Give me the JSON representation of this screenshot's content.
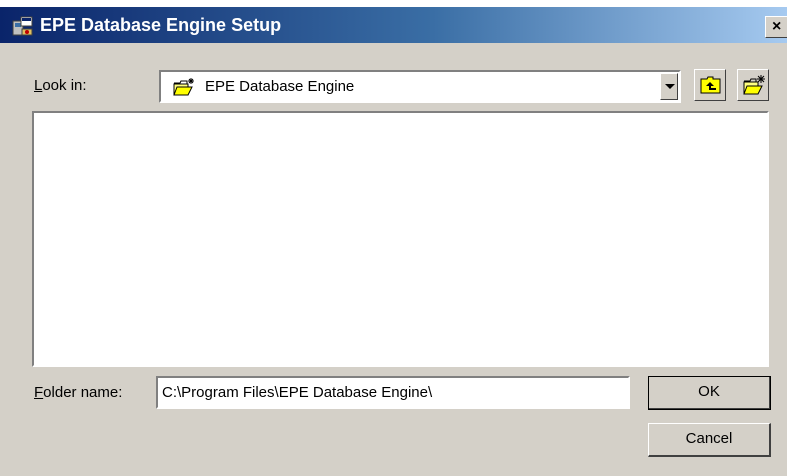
{
  "window": {
    "title": "EPE Database Engine Setup",
    "close_glyph": "×"
  },
  "look_in": {
    "label_hotkey": "L",
    "label_rest": "ook in:",
    "selected": "EPE Database Engine",
    "icon": "open-folder-icon"
  },
  "toolbar": {
    "up_icon": "up-one-level-icon",
    "new_folder_icon": "create-new-folder-icon"
  },
  "folder_name": {
    "label_hotkey": "F",
    "label_rest": "older name:",
    "value": "C:\\Program Files\\EPE Database Engine\\"
  },
  "buttons": {
    "ok": "OK",
    "cancel": "Cancel"
  },
  "colors": {
    "titlebar_start": "#0a246a",
    "titlebar_end": "#a6caf0",
    "face": "#d4d0c8"
  }
}
